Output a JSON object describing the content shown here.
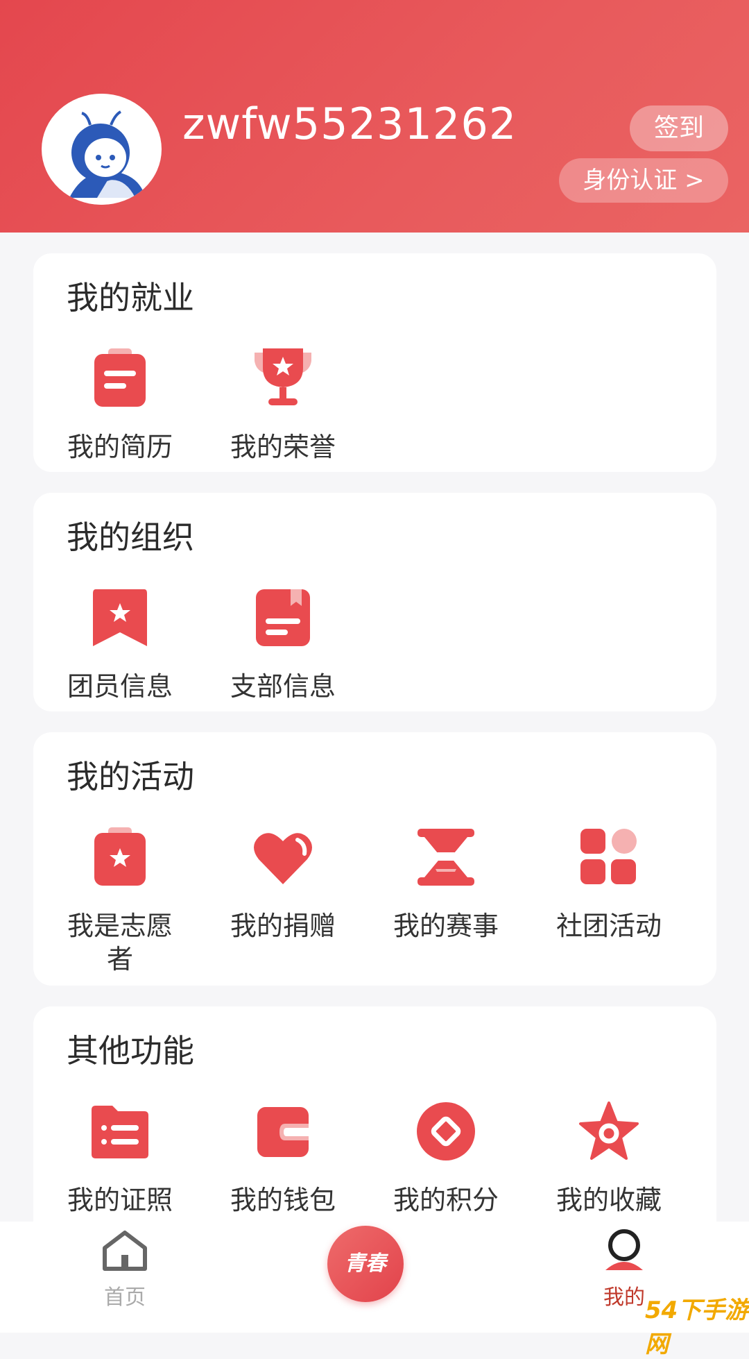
{
  "profile": {
    "username": "zwfw55231262",
    "signin_label": "签到",
    "auth_label": "身份认证 >"
  },
  "sections": [
    {
      "title": "我的就业",
      "items": [
        {
          "label": "我的简历",
          "icon": "resume-icon"
        },
        {
          "label": "我的荣誉",
          "icon": "trophy-icon"
        }
      ]
    },
    {
      "title": "我的组织",
      "items": [
        {
          "label": "团员信息",
          "icon": "member-badge-icon"
        },
        {
          "label": "支部信息",
          "icon": "branch-document-icon"
        }
      ]
    },
    {
      "title": "我的活动",
      "items": [
        {
          "label": "我是志愿者",
          "icon": "volunteer-clipboard-icon"
        },
        {
          "label": "我的捐赠",
          "icon": "heart-icon"
        },
        {
          "label": "我的赛事",
          "icon": "hourglass-icon"
        },
        {
          "label": "社团活动",
          "icon": "grid-icon"
        }
      ]
    },
    {
      "title": "其他功能",
      "items": [
        {
          "label": "我的证照",
          "icon": "folder-list-icon"
        },
        {
          "label": "我的钱包",
          "icon": "wallet-icon"
        },
        {
          "label": "我的积分",
          "icon": "points-coin-icon"
        },
        {
          "label": "我的收藏",
          "icon": "star-icon"
        }
      ]
    }
  ],
  "nav": {
    "home_label": "首页",
    "center_label": "青春",
    "mine_label": "我的"
  },
  "colors": {
    "accent": "#e4474e",
    "icon_red": "#e94b4f",
    "icon_light": "#f5b1b1",
    "nav_inactive": "#aaaaaa"
  },
  "watermark": "54下手游网"
}
